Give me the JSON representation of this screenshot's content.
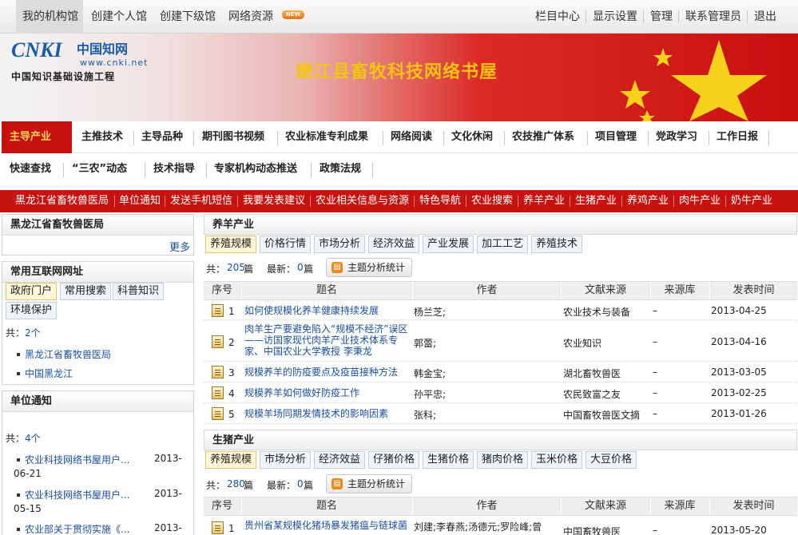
{
  "topbar": {
    "tabs": [
      "我的机构馆",
      "创建个人馆",
      "创建下级馆",
      "网络资源"
    ],
    "new_badge": "NEW",
    "right_links": [
      "栏目中心",
      "显示设置",
      "管理",
      "联系管理员",
      "退出"
    ]
  },
  "banner": {
    "logo_en": "CNKI",
    "logo_cn": "中国知网",
    "logo_url": "www.cnki.net",
    "logo_tagline": "中国知识基础设施工程",
    "title": "嫩江县畜牧科技网络书屋"
  },
  "nav": {
    "row1": [
      "主导产业",
      "主推技术",
      "主导品种",
      "期刊图书视频",
      "农业标准专利成果",
      "网络阅读",
      "文化休闲",
      "农技推广体系",
      "项目管理",
      "党政学习",
      "工作日报"
    ],
    "row2": [
      "快速查找",
      "“三农”动态",
      "技术指导",
      "专家机构动态推送",
      "政策法规"
    ]
  },
  "redbar": [
    "黑龙江省畜牧兽医局",
    "单位通知",
    "发送手机短信",
    "我要发表建议",
    "农业相关信息与资源",
    "特色导航",
    "农业搜索",
    "养羊产业",
    "生猪产业",
    "养鸡产业",
    "肉牛产业",
    "奶牛产业"
  ],
  "left": {
    "bureau": {
      "title": "黑龙江省畜牧兽医局",
      "more": "更多"
    },
    "links": {
      "title": "常用互联网网址",
      "tabs": [
        "政府门户",
        "常用搜索",
        "科普知识",
        "环境保护"
      ],
      "count_label": "共：",
      "count": "2个",
      "items": [
        "黑龙江省畜牧兽医局",
        "中国黑龙江"
      ]
    },
    "notices": {
      "title": "单位通知",
      "count_label": "共：",
      "count": "4个",
      "items": [
        {
          "title": "农业科技网络书屋用户...",
          "date1": "2013-",
          "date2": "06-21"
        },
        {
          "title": "农业科技网络书屋用户...",
          "date1": "2013-",
          "date2": "05-15"
        },
        {
          "title": "农业部关于贯彻实施《...",
          "date1": "2013-",
          "date2": ""
        }
      ]
    }
  },
  "sheep": {
    "title": "养羊产业",
    "tabs": [
      "养殖规模",
      "价格行情",
      "市场分析",
      "经济效益",
      "产业发展",
      "加工工艺",
      "养殖技术"
    ],
    "count_prefix": "共：",
    "count": "205",
    "count_unit": "篇",
    "latest_label": "最新：",
    "latest": "0",
    "latest_unit": "篇",
    "stats_button": "主题分析统计",
    "headers": [
      "序号",
      "题名",
      "作者",
      "文献来源",
      "来源库",
      "发表时间"
    ],
    "rows": [
      {
        "n": "1",
        "title": "如何使规模化养羊健康持续发展",
        "author": "杨兰芝;",
        "source": "农业技术与装备",
        "db": "–",
        "date": "2013-04-25"
      },
      {
        "n": "2",
        "title": "肉羊生产要避免陷入“规模不经济”误区——访国家现代肉羊产业技术体系专家、中国农业大学教授 李秉龙",
        "author": "郭蕾;",
        "source": "农业知识",
        "db": "–",
        "date": "2013-04-16"
      },
      {
        "n": "3",
        "title": "规模养羊的防疫要点及疫苗接种方法",
        "author": "韩金宝;",
        "source": "湖北畜牧兽医",
        "db": "–",
        "date": "2013-03-05"
      },
      {
        "n": "4",
        "title": "规模养羊如何做好防疫工作",
        "author": "孙平忠;",
        "source": "农民致富之友",
        "db": "–",
        "date": "2013-02-25"
      },
      {
        "n": "5",
        "title": "规模羊场同期发情技术的影响因素",
        "author": "张科;",
        "source": "中国畜牧兽医文摘",
        "db": "–",
        "date": "2013-01-26"
      }
    ]
  },
  "pig": {
    "title": "生猪产业",
    "tabs": [
      "养殖规模",
      "市场分析",
      "经济效益",
      "仔猪价格",
      "生猪价格",
      "猪肉价格",
      "玉米价格",
      "大豆价格"
    ],
    "count_prefix": "共：",
    "count": "280",
    "count_unit": "篇",
    "latest_label": "最新：",
    "latest": "0",
    "latest_unit": "篇",
    "stats_button": "主题分析统计",
    "headers": [
      "序号",
      "题名",
      "作者",
      "文献来源",
      "来源库",
      "发表时间"
    ],
    "rows": [
      {
        "n": "1",
        "title": "贵州省某规模化猪场暴发猪瘟与链球菌",
        "author": "刘建;李春燕;汤德元;罗险峰;曾",
        "source": "中国畜牧兽医",
        "db": "–",
        "date": "2013-05-20"
      }
    ]
  }
}
